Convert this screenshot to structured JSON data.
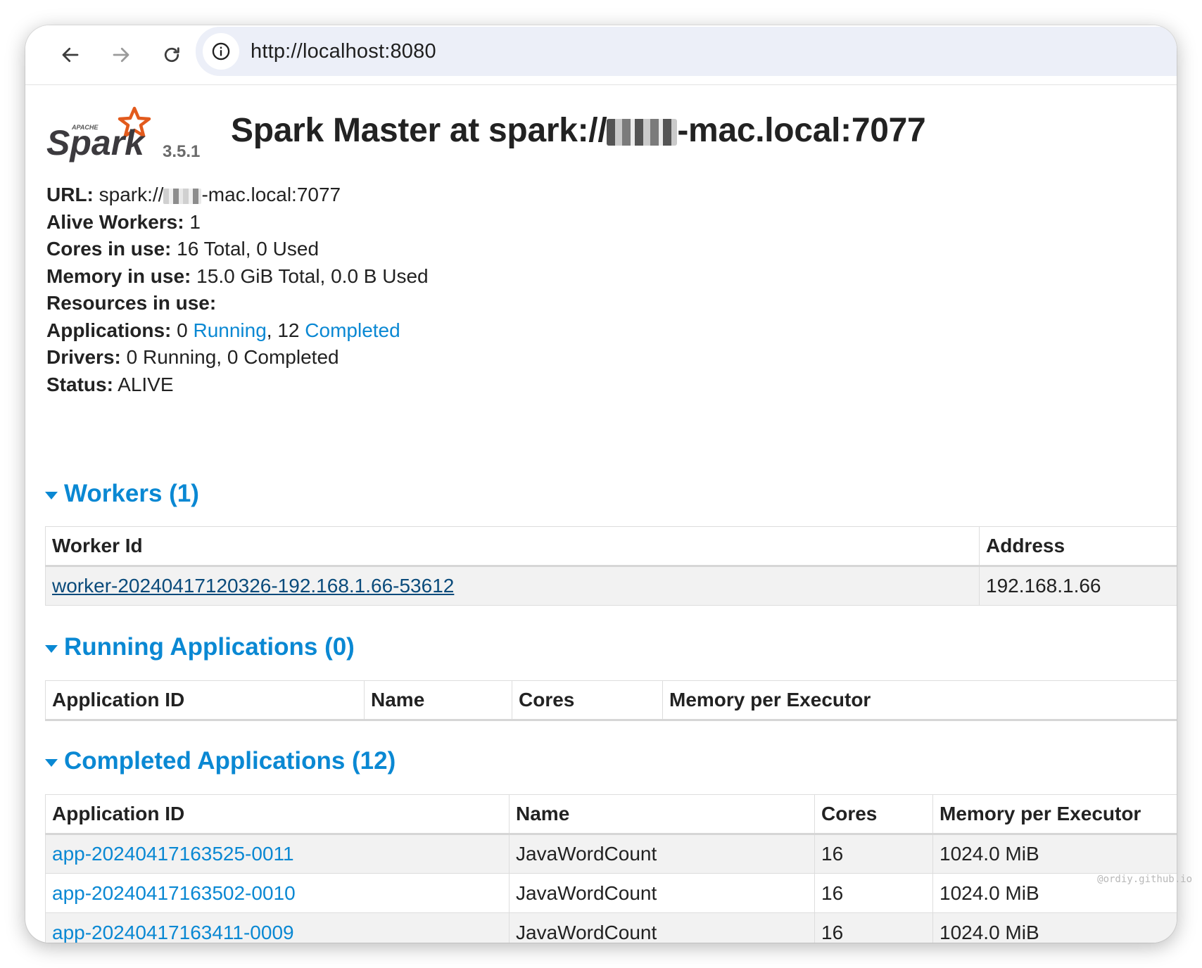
{
  "browser": {
    "url": "http://localhost:8080"
  },
  "header": {
    "logo_text": "Spark",
    "logo_small": "APACHE",
    "version": "3.5.1",
    "title_prefix": "Spark Master at spark://",
    "title_suffix": "-mac.local:7077"
  },
  "summary": {
    "url_label": "URL:",
    "url_prefix": "spark://",
    "url_suffix": "-mac.local:7077",
    "alive_workers_label": "Alive Workers:",
    "alive_workers": "1",
    "cores_label": "Cores in use:",
    "cores": "16 Total, 0 Used",
    "memory_label": "Memory in use:",
    "memory": "15.0 GiB Total, 0.0 B Used",
    "resources_label": "Resources in use:",
    "applications_label": "Applications:",
    "apps_running_count": "0",
    "apps_running_link": "Running",
    "apps_completed_count": "12",
    "apps_completed_link": "Completed",
    "drivers_label": "Drivers:",
    "drivers": "0 Running, 0 Completed",
    "status_label": "Status:",
    "status": "ALIVE"
  },
  "workers": {
    "heading": "Workers (1)",
    "columns": [
      "Worker Id",
      "Address"
    ],
    "rows": [
      {
        "id": "worker-20240417120326-192.168.1.66-53612",
        "address": "192.168.1.66"
      }
    ]
  },
  "running_apps": {
    "heading": "Running Applications (0)",
    "columns": [
      "Application ID",
      "Name",
      "Cores",
      "Memory per Executor"
    ]
  },
  "completed_apps": {
    "heading": "Completed Applications (12)",
    "columns": [
      "Application ID",
      "Name",
      "Cores",
      "Memory per Executor"
    ],
    "rows": [
      {
        "id": "app-20240417163525-0011",
        "name": "JavaWordCount",
        "cores": "16",
        "memory": "1024.0 MiB"
      },
      {
        "id": "app-20240417163502-0010",
        "name": "JavaWordCount",
        "cores": "16",
        "memory": "1024.0 MiB"
      },
      {
        "id": "app-20240417163411-0009",
        "name": "JavaWordCount",
        "cores": "16",
        "memory": "1024.0 MiB"
      }
    ]
  },
  "watermark": "@ordiy.github.io",
  "colors": {
    "link": "#0a88d3",
    "worker_link": "#0b4b7b",
    "address_bar": "#eceff8",
    "stripe": "#f2f2f2"
  }
}
